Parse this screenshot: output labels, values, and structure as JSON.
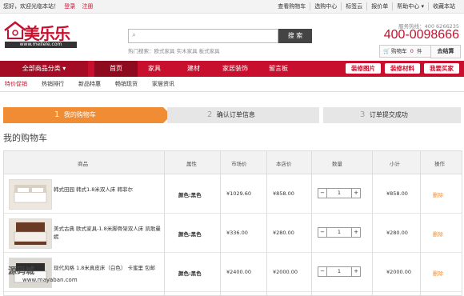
{
  "topbar": {
    "greeting": "您好，欢迎光临本站！",
    "login": "登录",
    "register": "注册",
    "links": [
      "查看购物车",
      "选购中心",
      "标签云",
      "报价单",
      "帮助中心 ▾",
      "收藏本站"
    ]
  },
  "logo": {
    "brand": "美乐乐",
    "url": "www.meilele.com"
  },
  "search": {
    "placeholder": "",
    "button": "搜 索",
    "hot_words": "热门搜索：欧式家具  实木家具  板式家具"
  },
  "service": {
    "label": "服务热线：400 6266235",
    "phone": "400-0098666"
  },
  "cart": {
    "label": "购物车",
    "count": "0",
    "unit": "件",
    "checkout": "去结算"
  },
  "nav": {
    "all_categories": "全部商品分类 ▾",
    "items": [
      "首页",
      "家具",
      "建材",
      "家居装饰",
      "留言板"
    ],
    "active": "首页",
    "buttons": [
      "装修图片",
      "装修材料",
      "我要买家"
    ]
  },
  "subnav": {
    "items": [
      "特价促销",
      "热销排行",
      "新品特惠",
      "畅销现货",
      "家居资讯"
    ]
  },
  "steps": [
    {
      "num": "1",
      "label": "我的购物车"
    },
    {
      "num": "2",
      "label": "确认订单信息"
    },
    {
      "num": "3",
      "label": "订单提交成功"
    }
  ],
  "page_title": "我的购物车",
  "table": {
    "headers": [
      "商品",
      "属性",
      "市场价",
      "本店价",
      "数量",
      "小计",
      "操作"
    ],
    "rows": [
      {
        "name": "韩式田园 韩式1.8米双人床 韩菲尔",
        "attr": "颜色:黑色",
        "market_price": "¥1029.60",
        "price": "¥858.00",
        "qty": "1",
        "subtotal": "¥858.00",
        "action": "删除"
      },
      {
        "name": "美式古典 欧式家具-1.8米脚骨架双人床 凯歌曼妮",
        "attr": "颜色:黑色",
        "market_price": "¥336.00",
        "price": "¥280.00",
        "qty": "1",
        "subtotal": "¥280.00",
        "action": "删除"
      },
      {
        "name": "现代风格 1.8米真皮床（白色） 卡蜜里 包邮",
        "attr": "颜色:黑色",
        "market_price": "¥2400.00",
        "price": "¥2000.00",
        "qty": "1",
        "subtotal": "¥2000.00",
        "action": "删除"
      }
    ]
  },
  "watermark": {
    "text": "源码城",
    "url": "www.mayaban.com"
  },
  "colors": {
    "brand_red": "#c8102e",
    "step_orange": "#f08c33"
  }
}
